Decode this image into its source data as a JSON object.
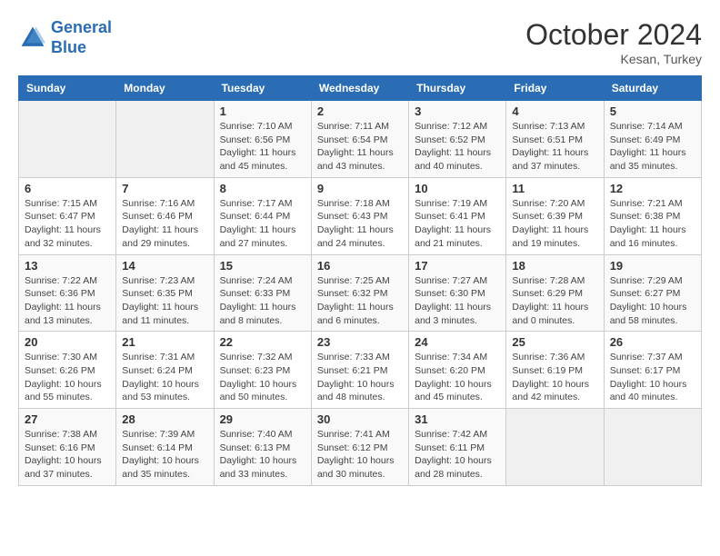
{
  "header": {
    "logo_line1": "General",
    "logo_line2": "Blue",
    "month_year": "October 2024",
    "location": "Kesan, Turkey"
  },
  "weekdays": [
    "Sunday",
    "Monday",
    "Tuesday",
    "Wednesday",
    "Thursday",
    "Friday",
    "Saturday"
  ],
  "weeks": [
    [
      {
        "day": "",
        "empty": true
      },
      {
        "day": "",
        "empty": true
      },
      {
        "day": "1",
        "sunrise": "7:10 AM",
        "sunset": "6:56 PM",
        "daylight": "11 hours and 45 minutes."
      },
      {
        "day": "2",
        "sunrise": "7:11 AM",
        "sunset": "6:54 PM",
        "daylight": "11 hours and 43 minutes."
      },
      {
        "day": "3",
        "sunrise": "7:12 AM",
        "sunset": "6:52 PM",
        "daylight": "11 hours and 40 minutes."
      },
      {
        "day": "4",
        "sunrise": "7:13 AM",
        "sunset": "6:51 PM",
        "daylight": "11 hours and 37 minutes."
      },
      {
        "day": "5",
        "sunrise": "7:14 AM",
        "sunset": "6:49 PM",
        "daylight": "11 hours and 35 minutes."
      }
    ],
    [
      {
        "day": "6",
        "sunrise": "7:15 AM",
        "sunset": "6:47 PM",
        "daylight": "11 hours and 32 minutes."
      },
      {
        "day": "7",
        "sunrise": "7:16 AM",
        "sunset": "6:46 PM",
        "daylight": "11 hours and 29 minutes."
      },
      {
        "day": "8",
        "sunrise": "7:17 AM",
        "sunset": "6:44 PM",
        "daylight": "11 hours and 27 minutes."
      },
      {
        "day": "9",
        "sunrise": "7:18 AM",
        "sunset": "6:43 PM",
        "daylight": "11 hours and 24 minutes."
      },
      {
        "day": "10",
        "sunrise": "7:19 AM",
        "sunset": "6:41 PM",
        "daylight": "11 hours and 21 minutes."
      },
      {
        "day": "11",
        "sunrise": "7:20 AM",
        "sunset": "6:39 PM",
        "daylight": "11 hours and 19 minutes."
      },
      {
        "day": "12",
        "sunrise": "7:21 AM",
        "sunset": "6:38 PM",
        "daylight": "11 hours and 16 minutes."
      }
    ],
    [
      {
        "day": "13",
        "sunrise": "7:22 AM",
        "sunset": "6:36 PM",
        "daylight": "11 hours and 13 minutes."
      },
      {
        "day": "14",
        "sunrise": "7:23 AM",
        "sunset": "6:35 PM",
        "daylight": "11 hours and 11 minutes."
      },
      {
        "day": "15",
        "sunrise": "7:24 AM",
        "sunset": "6:33 PM",
        "daylight": "11 hours and 8 minutes."
      },
      {
        "day": "16",
        "sunrise": "7:25 AM",
        "sunset": "6:32 PM",
        "daylight": "11 hours and 6 minutes."
      },
      {
        "day": "17",
        "sunrise": "7:27 AM",
        "sunset": "6:30 PM",
        "daylight": "11 hours and 3 minutes."
      },
      {
        "day": "18",
        "sunrise": "7:28 AM",
        "sunset": "6:29 PM",
        "daylight": "11 hours and 0 minutes."
      },
      {
        "day": "19",
        "sunrise": "7:29 AM",
        "sunset": "6:27 PM",
        "daylight": "10 hours and 58 minutes."
      }
    ],
    [
      {
        "day": "20",
        "sunrise": "7:30 AM",
        "sunset": "6:26 PM",
        "daylight": "10 hours and 55 minutes."
      },
      {
        "day": "21",
        "sunrise": "7:31 AM",
        "sunset": "6:24 PM",
        "daylight": "10 hours and 53 minutes."
      },
      {
        "day": "22",
        "sunrise": "7:32 AM",
        "sunset": "6:23 PM",
        "daylight": "10 hours and 50 minutes."
      },
      {
        "day": "23",
        "sunrise": "7:33 AM",
        "sunset": "6:21 PM",
        "daylight": "10 hours and 48 minutes."
      },
      {
        "day": "24",
        "sunrise": "7:34 AM",
        "sunset": "6:20 PM",
        "daylight": "10 hours and 45 minutes."
      },
      {
        "day": "25",
        "sunrise": "7:36 AM",
        "sunset": "6:19 PM",
        "daylight": "10 hours and 42 minutes."
      },
      {
        "day": "26",
        "sunrise": "7:37 AM",
        "sunset": "6:17 PM",
        "daylight": "10 hours and 40 minutes."
      }
    ],
    [
      {
        "day": "27",
        "sunrise": "7:38 AM",
        "sunset": "6:16 PM",
        "daylight": "10 hours and 37 minutes."
      },
      {
        "day": "28",
        "sunrise": "7:39 AM",
        "sunset": "6:14 PM",
        "daylight": "10 hours and 35 minutes."
      },
      {
        "day": "29",
        "sunrise": "7:40 AM",
        "sunset": "6:13 PM",
        "daylight": "10 hours and 33 minutes."
      },
      {
        "day": "30",
        "sunrise": "7:41 AM",
        "sunset": "6:12 PM",
        "daylight": "10 hours and 30 minutes."
      },
      {
        "day": "31",
        "sunrise": "7:42 AM",
        "sunset": "6:11 PM",
        "daylight": "10 hours and 28 minutes."
      },
      {
        "day": "",
        "empty": true
      },
      {
        "day": "",
        "empty": true
      }
    ]
  ]
}
